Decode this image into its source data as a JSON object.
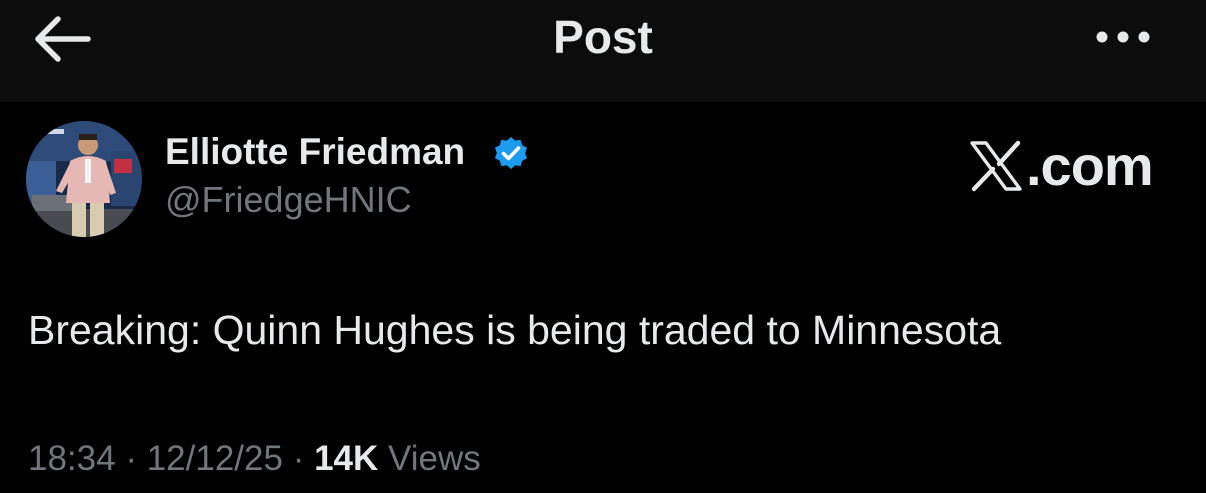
{
  "header": {
    "title": "Post",
    "back_icon": "arrow-left-icon",
    "more_icon": "more-horizontal-icon"
  },
  "tweet": {
    "author": {
      "display_name": "Elliotte Friedman",
      "handle": "@FriedgeHNIC",
      "verified_icon": "verified-badge-icon"
    },
    "watermark": {
      "logo_text": "X",
      "text": ".com"
    },
    "text": "Breaking: Quinn Hughes is being traded to Minnesota",
    "meta": {
      "time": "18:34",
      "separator": "·",
      "date": "12/12/25",
      "views_count": "14K",
      "views_label": "Views"
    }
  },
  "colors": {
    "background": "#000000",
    "header_background": "#0c0c0c",
    "primary_text": "#e7e9ea",
    "secondary_text": "#71767b",
    "verified_blue": "#1d9bf0"
  }
}
